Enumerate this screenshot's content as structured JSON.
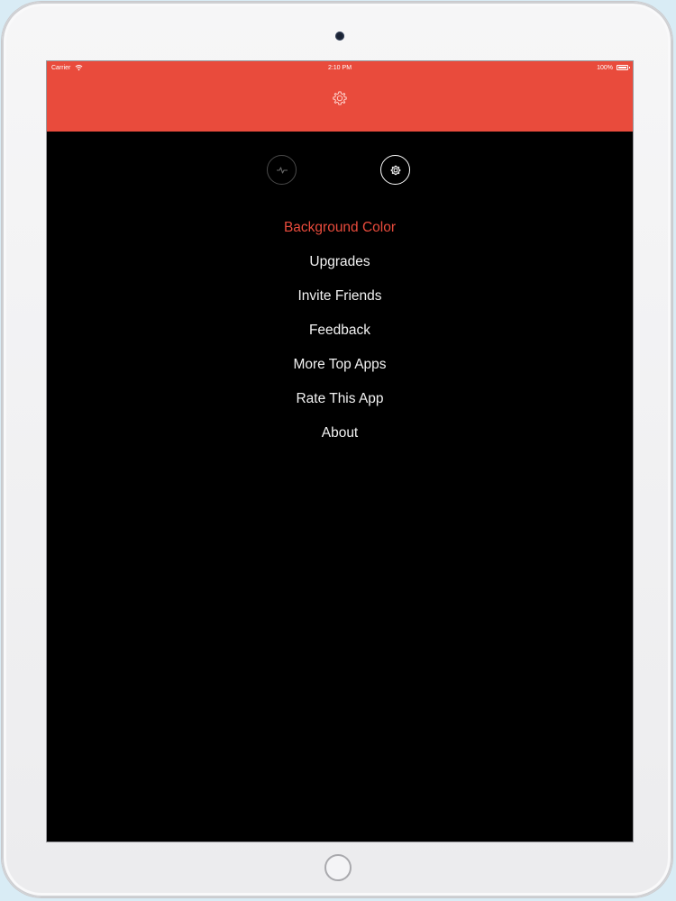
{
  "status_bar": {
    "carrier": "Carrier",
    "time": "2:10 PM",
    "battery": "100%"
  },
  "header": {
    "icon": "gear-icon",
    "background_color": "#e94b3c"
  },
  "toggles": [
    {
      "icon": "activity-icon",
      "selected": false
    },
    {
      "icon": "gear-icon",
      "selected": true
    }
  ],
  "menu": {
    "items": [
      {
        "label": "Background Color",
        "active": true
      },
      {
        "label": "Upgrades",
        "active": false
      },
      {
        "label": "Invite Friends",
        "active": false
      },
      {
        "label": "Feedback",
        "active": false
      },
      {
        "label": "More Top Apps",
        "active": false
      },
      {
        "label": "Rate This App",
        "active": false
      },
      {
        "label": "About",
        "active": false
      }
    ]
  },
  "colors": {
    "accent": "#e94b3c",
    "screen_background": "#000000",
    "menu_text": "#f2f2f2"
  }
}
